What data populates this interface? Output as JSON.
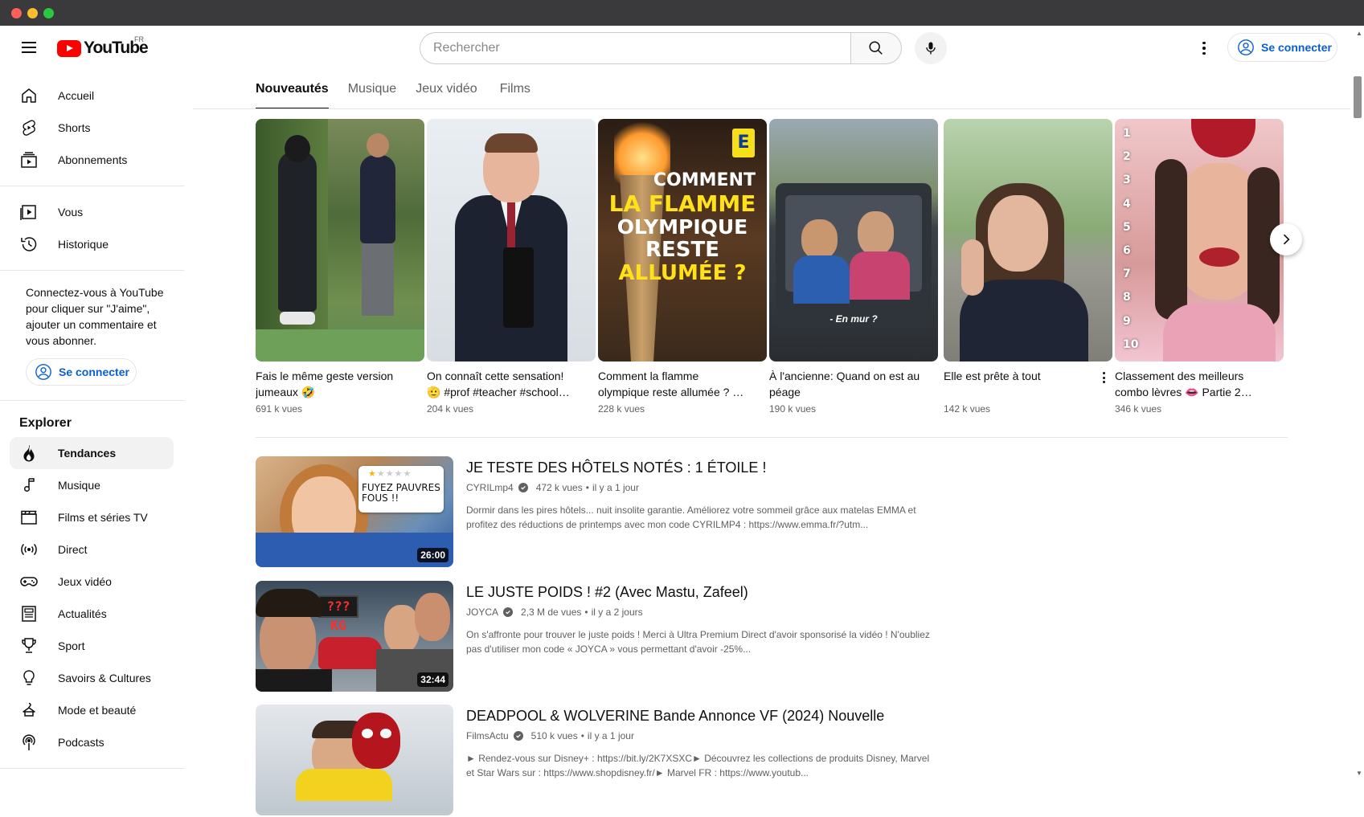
{
  "masthead": {
    "logo_text": "YouTube",
    "country": "FR",
    "search_placeholder": "Rechercher",
    "signin_label": "Se connecter"
  },
  "sidebar": {
    "main_items": [
      {
        "label": "Accueil",
        "icon": "home-icon"
      },
      {
        "label": "Shorts",
        "icon": "shorts-icon"
      },
      {
        "label": "Abonnements",
        "icon": "subscriptions-icon"
      }
    ],
    "you_items": [
      {
        "label": "Vous",
        "icon": "library-icon"
      },
      {
        "label": "Historique",
        "icon": "history-icon"
      }
    ],
    "signin_promo": "Connectez-vous à YouTube pour cliquer sur \"J'aime\", ajouter un commentaire et vous abonner.",
    "signin_label": "Se connecter",
    "explore_title": "Explorer",
    "explore_items": [
      {
        "label": "Tendances",
        "icon": "trending-icon",
        "active": true
      },
      {
        "label": "Musique",
        "icon": "music-icon"
      },
      {
        "label": "Films et séries TV",
        "icon": "movies-icon"
      },
      {
        "label": "Direct",
        "icon": "live-icon"
      },
      {
        "label": "Jeux vidéo",
        "icon": "gaming-icon"
      },
      {
        "label": "Actualités",
        "icon": "news-icon"
      },
      {
        "label": "Sport",
        "icon": "trophy-icon"
      },
      {
        "label": "Savoirs & Cultures",
        "icon": "lightbulb-icon"
      },
      {
        "label": "Mode et beauté",
        "icon": "hanger-icon"
      },
      {
        "label": "Podcasts",
        "icon": "podcast-icon"
      }
    ]
  },
  "tabs": [
    "Nouveautés",
    "Musique",
    "Jeux vidéo",
    "Films"
  ],
  "shorts": [
    {
      "title": "Fais le même geste version jumeaux 🤣",
      "views": "691 k vues"
    },
    {
      "title": "On connaît cette sensation! 🫡 #prof #teacher #school…",
      "views": "204 k vues"
    },
    {
      "title": "Comment la flamme olympique reste allumée ? …",
      "views": "228 k vues",
      "thumb_text": [
        "COMMENT",
        "LA FLAMME",
        "OLYMPIQUE",
        "RESTE",
        "ALLUMÉE ?"
      ],
      "badge": "E"
    },
    {
      "title": "À l'ancienne: Quand on est au péage",
      "views": "190 k vues",
      "thumb_text": "- En mur ?"
    },
    {
      "title": "Elle est prête à tout",
      "views": "142 k vues"
    },
    {
      "title": "Classement des meilleurs combo lèvres 👄 Partie 2…",
      "views": "346 k vues",
      "ranks": [
        "1",
        "2",
        "3",
        "4",
        "5",
        "6",
        "7",
        "8",
        "9",
        "10"
      ]
    }
  ],
  "videos": [
    {
      "title": "JE TESTE DES HÔTELS NOTÉS : 1 ÉTOILE !",
      "channel": "CYRILmp4",
      "views": "472 k vues",
      "age": "il y a 1 jour",
      "description": "Dormir dans les pires hôtels... nuit insolite garantie. Améliorez votre sommeil grâce aux matelas EMMA et profitez des réductions de printemps avec mon code CYRILMP4 : https://www.emma.fr/?utm...",
      "duration": "26:00",
      "thumb_text": "FUYEZ PAUVRES FOUS !!"
    },
    {
      "title": "LE JUSTE POIDS ! #2 (Avec Mastu, Zafeel)",
      "channel": "JOYCA",
      "views": "2,3 M de vues",
      "age": "il y a 2 jours",
      "description": "On s'affronte pour trouver le juste poids ! Merci à Ultra Premium Direct d'avoir sponsorisé la vidéo ! N'oubliez pas d'utiliser mon code « JOYCA » vous permettant d'avoir -25%...",
      "duration": "32:44",
      "thumb_text": "??? KG"
    },
    {
      "title": "DEADPOOL & WOLVERINE Bande Annonce VF (2024) Nouvelle",
      "channel": "FilmsActu",
      "views": "510 k vues",
      "age": "il y a 1 jour",
      "description": "► Rendez-vous sur Disney+ : https://bit.ly/2K7XSXC► Découvrez les collections de produits Disney, Marvel et Star Wars sur : https://www.shopdisney.fr/► Marvel FR : https://www.youtub..."
    }
  ],
  "colors": {
    "brand_red": "#ff0000",
    "link_blue": "#065fd4",
    "text": "#0f0f0f",
    "secondary": "#606060"
  }
}
